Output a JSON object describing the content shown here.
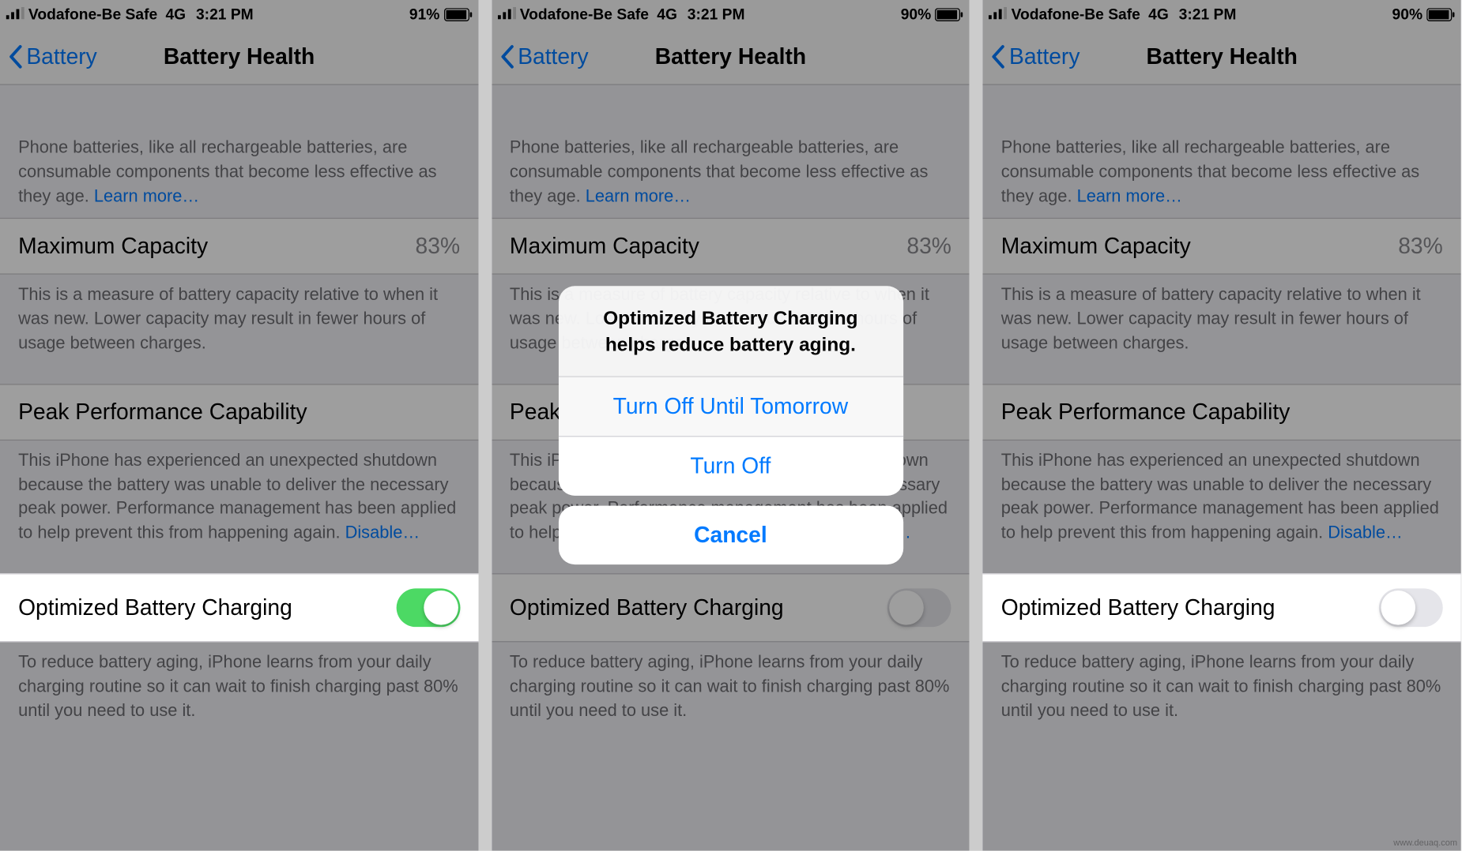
{
  "statusbar": {
    "carrier": "Vodafone-Be Safe",
    "network": "4G",
    "time": "3:21 PM",
    "battery_pct_a": "91%",
    "battery_pct_b": "90%",
    "battery_pct_c": "90%"
  },
  "nav": {
    "back_label": "Battery",
    "title": "Battery Health"
  },
  "intro": {
    "text": "Phone batteries, like all rechargeable batteries, are consumable components that become less effective as they age. ",
    "learn_more": "Learn more…"
  },
  "capacity": {
    "label": "Maximum Capacity",
    "value": "83%",
    "footer": "This is a measure of battery capacity relative to when it was new. Lower capacity may result in fewer hours of usage between charges."
  },
  "peak": {
    "label": "Peak Performance Capability",
    "footer": "This iPhone has experienced an unexpected shutdown because the battery was unable to deliver the necessary peak power. Performance management has been applied to help prevent this from happening again. ",
    "disable": "Disable…"
  },
  "optimized": {
    "label": "Optimized Battery Charging",
    "footer": "To reduce battery aging, iPhone learns from your daily charging routine so it can wait to finish charging past 80% until you need to use it."
  },
  "sheet": {
    "title": "Optimized Battery Charging helps reduce battery aging.",
    "opt1": "Turn Off Until Tomorrow",
    "opt2": "Turn Off",
    "cancel": "Cancel"
  },
  "watermark": "www.deuaq.com"
}
